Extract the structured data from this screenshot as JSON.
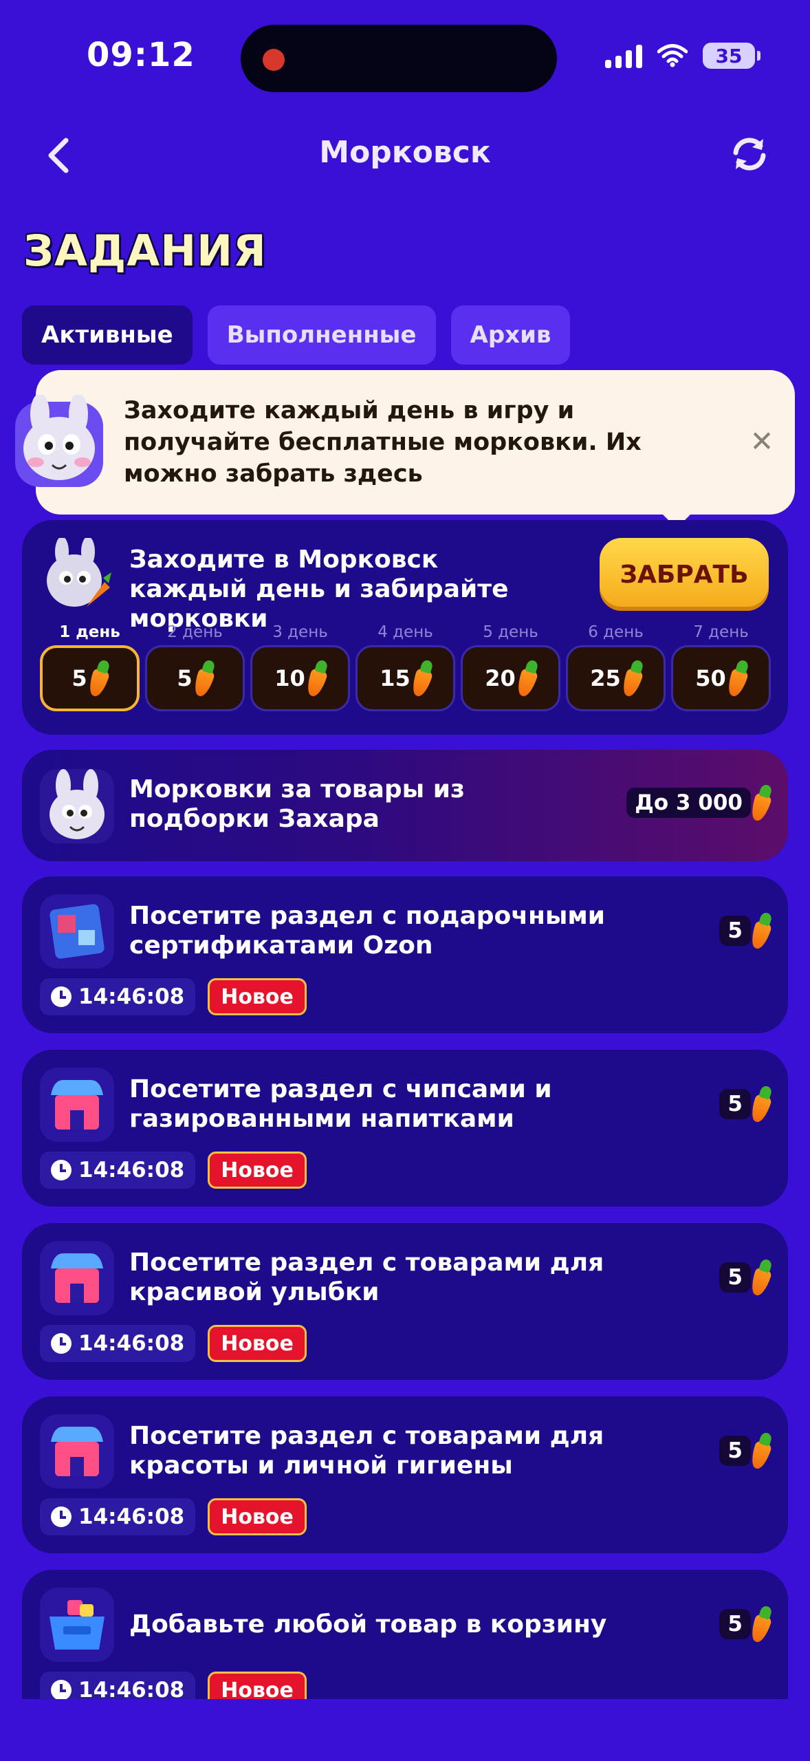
{
  "status_bar": {
    "time": "09:12",
    "battery": "35"
  },
  "header": {
    "title": "Морковск"
  },
  "page_heading": "ЗАДАНИЯ",
  "tabs": [
    {
      "label": "Активные",
      "active": true
    },
    {
      "label": "Выполненные",
      "active": false
    },
    {
      "label": "Архив",
      "active": false
    }
  ],
  "tooltip": {
    "text": "Заходите каждый день в игру и получайте бесплатные морковки. Их можно забрать здесь"
  },
  "daily": {
    "title": "Заходите в Морковск каждый день и забирайте морковки",
    "claim_label": "ЗАБРАТЬ",
    "days": [
      {
        "label": "1 день",
        "value": "5",
        "current": true
      },
      {
        "label": "2 день",
        "value": "5",
        "current": false
      },
      {
        "label": "3 день",
        "value": "10",
        "current": false
      },
      {
        "label": "4 день",
        "value": "15",
        "current": false
      },
      {
        "label": "5 день",
        "value": "20",
        "current": false
      },
      {
        "label": "6 день",
        "value": "25",
        "current": false
      },
      {
        "label": "7 день",
        "value": "50",
        "current": false
      }
    ]
  },
  "promo": {
    "title": "Морковки за товары из подборки Захара",
    "reward": "До 3 000"
  },
  "tasks": [
    {
      "title": "Посетите раздел с подарочными сертификатами Ozon",
      "reward": "5",
      "timer": "14:46:08",
      "badge": "Новое",
      "icon": "gift-card-icon"
    },
    {
      "title": "Посетите раздел с чипсами и газированными напитками",
      "reward": "5",
      "timer": "14:46:08",
      "badge": "Новое",
      "icon": "store-icon"
    },
    {
      "title": "Посетите раздел с товарами для красивой улыбки",
      "reward": "5",
      "timer": "14:46:08",
      "badge": "Новое",
      "icon": "store-icon"
    },
    {
      "title": "Посетите раздел с товарами для красоты и личной гигиены",
      "reward": "5",
      "timer": "14:46:08",
      "badge": "Новое",
      "icon": "store-icon"
    },
    {
      "title": "Добавьте любой товар в корзину",
      "reward": "5",
      "timer": "14:46:08",
      "badge": "Новое",
      "icon": "basket-icon"
    }
  ],
  "colors": {
    "background": "#3a0fd6",
    "card": "#1d0b8c",
    "accent": "#ffd84a",
    "badge": "#e5132b"
  },
  "icons": [
    "back-arrow-icon",
    "refresh-icon",
    "close-icon",
    "carrot-icon",
    "clock-icon",
    "bunny-icon"
  ]
}
